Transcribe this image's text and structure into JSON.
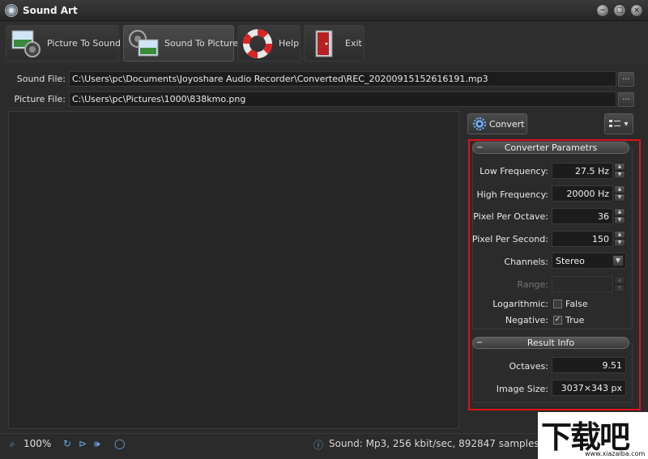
{
  "window": {
    "title": "Sound Art",
    "buttons": {
      "minimize": "−",
      "restore": "▢",
      "close": "×"
    }
  },
  "toolbar": {
    "items": [
      {
        "label": "Picture To Sound",
        "icon": "picture-to-sound-icon"
      },
      {
        "label": "Sound To Picture",
        "icon": "sound-to-picture-icon",
        "active": true
      },
      {
        "label": "Help",
        "icon": "lifebuoy-icon"
      },
      {
        "label": "Exit",
        "icon": "exit-door-icon"
      }
    ]
  },
  "files": {
    "sound_label": "Sound File:",
    "sound_value": "C:\\Users\\pc\\Documents\\Joyoshare Audio Recorder\\Converted\\REC_20200915152616191.mp3",
    "picture_label": "Picture File:",
    "picture_value": "C:\\Users\\pc\\Pictures\\1000\\838kmo.png",
    "browse": "..."
  },
  "actions": {
    "convert": "Convert",
    "view_menu": "▾"
  },
  "converter": {
    "header": "Converter Parametrs",
    "low_freq_label": "Low Frequency:",
    "low_freq_value": "27.5 Hz",
    "high_freq_label": "High Frequency:",
    "high_freq_value": "20000 Hz",
    "ppo_label": "Pixel Per Octave:",
    "ppo_value": "36",
    "pps_label": "Pixel Per Second:",
    "pps_value": "150",
    "channels_label": "Channels:",
    "channels_value": "Stereo",
    "range_label": "Range:",
    "range_value": "",
    "log_label": "Logarithmic:",
    "log_value": "False",
    "log_checked": false,
    "neg_label": "Negative:",
    "neg_value": "True",
    "neg_checked": true
  },
  "result": {
    "header": "Result Info",
    "octaves_label": "Octaves:",
    "octaves_value": "9.51",
    "size_label": "Image Size:",
    "size_value": "3037×343 px"
  },
  "status": {
    "zoom": "100%",
    "info": "Sound: Mp3, 256 kbit/sec, 892847 samples, ..."
  },
  "watermark": {
    "big": "下载吧",
    "small": "www.xiazaiba.com"
  },
  "colors": {
    "accent": "#6ba8e6",
    "highlight_border": "#e0121b"
  }
}
